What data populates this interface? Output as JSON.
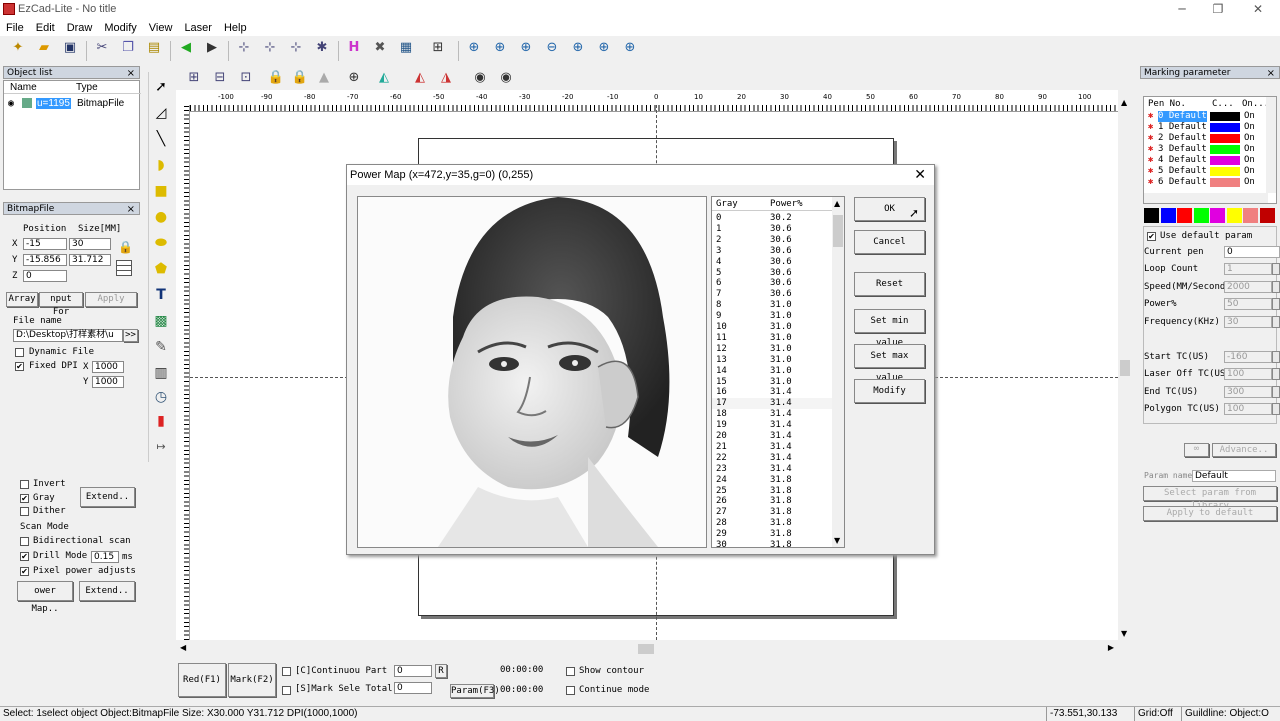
{
  "app": {
    "title": "EzCad-Lite - No title",
    "menu": [
      "File",
      "Edit",
      "Draw",
      "Modify",
      "View",
      "Laser",
      "Help"
    ]
  },
  "object_list": {
    "title": "Object list",
    "col_name": "Name",
    "col_type": "Type",
    "items": [
      {
        "name": "u=1195",
        "type": "BitmapFile"
      }
    ]
  },
  "bitmap_panel": {
    "title": "BitmapFile",
    "position_label": "Position",
    "size_label": "Size[MM]",
    "x_label": "X",
    "y_label": "Y",
    "z_label": "Z",
    "x_pos": "-15",
    "x_size": "30",
    "y_pos": "-15.856",
    "y_size": "31.712",
    "z_pos": "0",
    "array_btn": "Array",
    "input_btn": "nput For",
    "apply_btn": "Apply",
    "file_name_label": "File name",
    "file_path": "D:\\Desktop\\打样素材\\u",
    "browse_btn": ">>",
    "dynamic_file": "Dynamic File",
    "fixed_dpi": "Fixed DPI",
    "dpi_x_label": "X",
    "dpi_y_label": "Y",
    "dpi_x": "1000",
    "dpi_y": "1000",
    "invert": "Invert",
    "gray": "Gray",
    "dither": "Dither",
    "extend_btn": "Extend..",
    "scan_mode": "Scan Mode",
    "bidirectional": "Bidirectional scan",
    "drill_mode": "Drill Mode",
    "drill_value": "0.15",
    "drill_unit": "ms",
    "pixel_power": "Pixel power adjusts",
    "power_map_btn": "ower Map..",
    "extend2_btn": "Extend.."
  },
  "ruler": {
    "h_labels": [
      "-100",
      "-90",
      "-80",
      "-70",
      "-60",
      "-50",
      "-40",
      "-30",
      "-20",
      "-10",
      "0",
      "10",
      "20",
      "30",
      "40",
      "50",
      "60",
      "70",
      "80",
      "90",
      "100"
    ]
  },
  "dialog": {
    "title": "Power Map (x=472,y=35,g=0) (0,255)",
    "col_gray": "Gray",
    "col_power": "Power%",
    "rows": [
      [
        "0",
        "30.2"
      ],
      [
        "1",
        "30.6"
      ],
      [
        "2",
        "30.6"
      ],
      [
        "3",
        "30.6"
      ],
      [
        "4",
        "30.6"
      ],
      [
        "5",
        "30.6"
      ],
      [
        "6",
        "30.6"
      ],
      [
        "7",
        "30.6"
      ],
      [
        "8",
        "31.0"
      ],
      [
        "9",
        "31.0"
      ],
      [
        "10",
        "31.0"
      ],
      [
        "11",
        "31.0"
      ],
      [
        "12",
        "31.0"
      ],
      [
        "13",
        "31.0"
      ],
      [
        "14",
        "31.0"
      ],
      [
        "15",
        "31.0"
      ],
      [
        "16",
        "31.4"
      ],
      [
        "17",
        "31.4"
      ],
      [
        "18",
        "31.4"
      ],
      [
        "19",
        "31.4"
      ],
      [
        "20",
        "31.4"
      ],
      [
        "21",
        "31.4"
      ],
      [
        "22",
        "31.4"
      ],
      [
        "23",
        "31.4"
      ],
      [
        "24",
        "31.8"
      ],
      [
        "25",
        "31.8"
      ],
      [
        "26",
        "31.8"
      ],
      [
        "27",
        "31.8"
      ],
      [
        "28",
        "31.8"
      ],
      [
        "29",
        "31.8"
      ],
      [
        "30",
        "31.8"
      ]
    ],
    "ok": "OK",
    "cancel": "Cancel",
    "reset": "Reset",
    "set_min": "Set min value",
    "set_max": "Set max value",
    "modify": "Modify"
  },
  "marking": {
    "title": "Marking parameter",
    "col_pen": "Pen No.",
    "col_color": "C...",
    "col_on": "On...",
    "pens": [
      {
        "label": "0 Default",
        "color": "#000000",
        "on": "On"
      },
      {
        "label": "1 Default",
        "color": "#0000ff",
        "on": "On"
      },
      {
        "label": "2 Default",
        "color": "#ff0000",
        "on": "On"
      },
      {
        "label": "3 Default",
        "color": "#00ff00",
        "on": "On"
      },
      {
        "label": "4 Default",
        "color": "#e000e0",
        "on": "On"
      },
      {
        "label": "5 Default",
        "color": "#ffff00",
        "on": "On"
      },
      {
        "label": "6 Default",
        "color": "#f08080",
        "on": "On"
      }
    ],
    "palette": [
      "#000000",
      "#0000ff",
      "#ff0000",
      "#00ff00",
      "#e000e0",
      "#ffff00",
      "#f08080",
      "#c00000"
    ],
    "use_default": "Use default param",
    "current_pen_label": "Current pen",
    "current_pen": "0",
    "loop_label": "Loop Count",
    "loop": "1",
    "speed_label": "Speed(MM/Second",
    "speed": "2000",
    "power_label": "Power%",
    "power": "50",
    "freq_label": "Frequency(KHz)",
    "freq": "30",
    "start_tc_label": "Start TC(US)",
    "start_tc": "-160",
    "laser_off_label": "Laser Off TC(US",
    "laser_off": "100",
    "end_tc_label": "End TC(US)",
    "end_tc": "300",
    "polygon_label": "Polygon TC(US)",
    "polygon": "100",
    "advance": "Advance..",
    "param_name_label": "Param name",
    "param_name": "Default",
    "select_param": "Select param from library",
    "apply_default": "Apply to default"
  },
  "bottom": {
    "red": "Red(F1)",
    "mark": "Mark(F2)",
    "continuous": "[C]Continuou Part",
    "mark_sel": "[S]Mark Sele Total",
    "part_val": "0",
    "total_val": "0",
    "r_btn": "R",
    "time1": "00:00:00",
    "time2": "00:00:00",
    "param_btn": "Param(F3)",
    "show_contour": "Show contour",
    "continue_mode": "Continue mode"
  },
  "status": {
    "message": "Select: 1select object Object:BitmapFile Size: X30.000 Y31.712 DPI(1000,1000)",
    "coords": "-73.551,30.133",
    "grid": "Grid:Off",
    "guideline": "Guildline: Object:O"
  }
}
